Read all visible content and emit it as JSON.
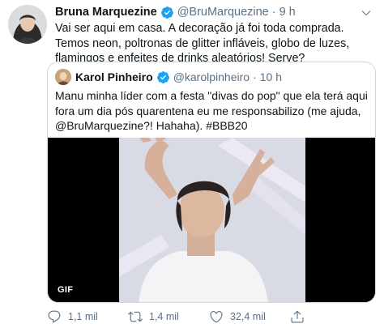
{
  "tweet": {
    "author_name": "Bruna Marquezine",
    "handle": "@BruMarquezine",
    "separator": "·",
    "time": "9 h",
    "verified_icon": "verified-badge-icon",
    "text": "Vai ser aqui em casa. A decoração já foi toda comprada. Temos neon, poltronas de glitter infláveis, globo de luzes, flamingos e enfeites de drinks aleatórios! Serve?"
  },
  "quoted": {
    "author_name": "Karol Pinheiro",
    "handle": "@karolpinheiro",
    "separator": "·",
    "time": "10 h",
    "text": "Manu minha líder com a festa \"divas do pop\" que ela terá aqui fora um dia pós quarentena eu me responsabilizo (me ajuda, @BruMarquezine?! Hahaha). #BBB20",
    "media": {
      "type": "gif",
      "badge": "GIF"
    }
  },
  "actions": {
    "reply": {
      "icon": "reply-icon",
      "count": "1,1 mil"
    },
    "retweet": {
      "icon": "retweet-icon",
      "count": "1,4 mil"
    },
    "like": {
      "icon": "heart-icon",
      "count": "32,4 mil"
    },
    "share": {
      "icon": "share-icon"
    }
  },
  "colors": {
    "verified": "#1da1f2",
    "secondary_text": "#5b7083",
    "border": "#cfd9de"
  }
}
